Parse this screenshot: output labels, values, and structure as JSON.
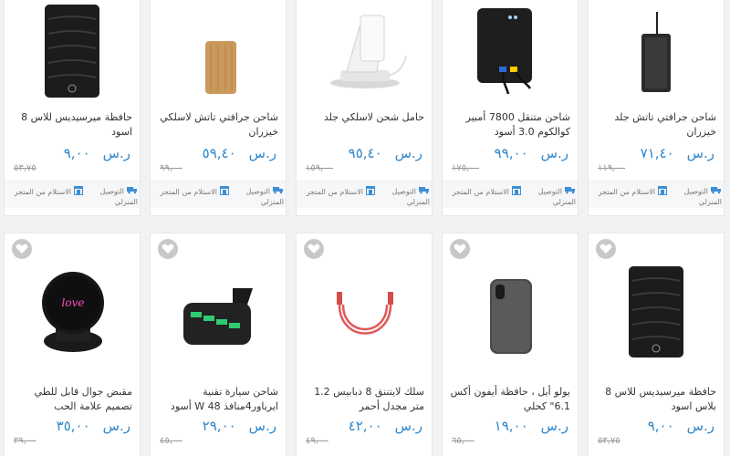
{
  "currency": "ر.س",
  "delivery": {
    "home": "التوصيل المنزلي",
    "store": "الاستلام من المتجر"
  },
  "row1": [
    {
      "name": "شاحن جرافتي تاتش جلد خيزران",
      "price": "٧١,٤٠",
      "old": "١١٩,٠٠",
      "image": "wireless-pad-leather"
    },
    {
      "name": "شاحن متنقل 7800 أمبير كوالكوم 3.0 أسود",
      "price": "٩٩,٠٠",
      "old": "١٧٥,٠٠",
      "image": "power-bank"
    },
    {
      "name": "حامل شحن لاسلكي جلد",
      "price": "٩٥,٤٠",
      "old": "١٥٩,٠٠",
      "image": "wireless-stand"
    },
    {
      "name": "شاحن جرافتي تاتش لاسلكي خيزران",
      "price": "٥٩,٤٠",
      "old": "٩٩,٠٠",
      "image": "bamboo-charger"
    },
    {
      "name": "حافظة ميرسيديس للاس 8 اسود",
      "price": "٩,٠٠",
      "old": "٥٣,٧٥",
      "image": "mercedes-case"
    }
  ],
  "row2": [
    {
      "name": "حافظة ميرسيديس للاس 8 بلاس اسود",
      "price": "٩,٠٠",
      "old": "٥٣,٧٥",
      "image": "mercedes-case"
    },
    {
      "name": "بولو أيل ، حافظة أيفون أكس 6.1\" كحلي",
      "price": "١٩,٠٠",
      "old": "٦٥,٠٠",
      "image": "iphone-case"
    },
    {
      "name": "سلك لايتننق 8 دبابيس 1.2 متر مجدل أحمر",
      "price": "٤٢,٠٠",
      "old": "٤٩,٠٠",
      "image": "red-cable"
    },
    {
      "name": "شاحن سيارة تقنية ايرباور4منافذ 48 W أسود",
      "price": "٢٩,٠٠",
      "old": "٤٥,٠٠",
      "image": "car-charger"
    },
    {
      "name": "مقبض جوال قابل للطي تصميم علامة الحب",
      "price": "٣٥,٠٠",
      "old": "٣٩,٠٠",
      "image": "love-popsocket"
    }
  ]
}
